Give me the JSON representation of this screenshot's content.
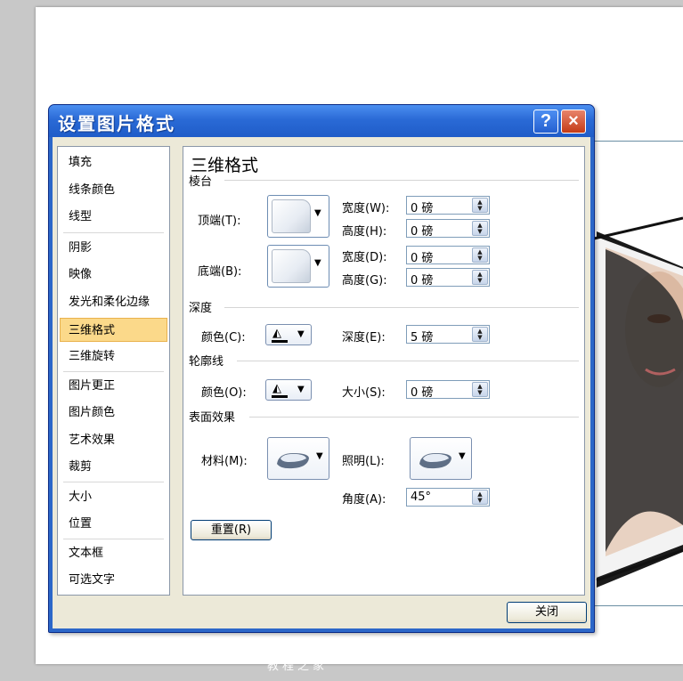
{
  "dialog": {
    "title": "设置图片格式",
    "help_label": "?",
    "close_x_label": "×",
    "close_button_label": "关闭"
  },
  "nav": {
    "items": [
      {
        "label": "填充",
        "active": false
      },
      {
        "label": "线条颜色",
        "active": false
      },
      {
        "label": "线型",
        "active": false
      },
      {
        "label": "阴影",
        "active": false
      },
      {
        "label": "映像",
        "active": false
      },
      {
        "label": "发光和柔化边缘",
        "active": false
      },
      {
        "label": "三维格式",
        "active": true
      },
      {
        "label": "三维旋转",
        "active": false
      },
      {
        "label": "图片更正",
        "active": false
      },
      {
        "label": "图片颜色",
        "active": false
      },
      {
        "label": "艺术效果",
        "active": false
      },
      {
        "label": "裁剪",
        "active": false
      },
      {
        "label": "大小",
        "active": false
      },
      {
        "label": "位置",
        "active": false
      },
      {
        "label": "文本框",
        "active": false
      },
      {
        "label": "可选文字",
        "active": false
      }
    ]
  },
  "panel": {
    "title": "三维格式",
    "bevel": {
      "section": "棱台",
      "top_label": "顶端(T):",
      "bottom_label": "底端(B):",
      "top_width_label": "宽度(W):",
      "top_width_value": "0 磅",
      "top_height_label": "高度(H):",
      "top_height_value": "0 磅",
      "bottom_width_label": "宽度(D):",
      "bottom_width_value": "0 磅",
      "bottom_height_label": "高度(G):",
      "bottom_height_value": "0 磅"
    },
    "depth": {
      "section": "深度",
      "color_label": "颜色(C):",
      "depth_label": "深度(E):",
      "depth_value": "5 磅"
    },
    "contour": {
      "section": "轮廓线",
      "color_label": "颜色(O):",
      "size_label": "大小(S):",
      "size_value": "0 磅"
    },
    "surface": {
      "section": "表面效果",
      "material_label": "材料(M):",
      "lighting_label": "照明(L):",
      "angle_label": "角度(A):",
      "angle_value": "45°"
    },
    "reset_label": "重置(R)"
  },
  "watermark": "教程之家",
  "colors": {
    "title_bar": "#2a6ad6",
    "dialog_body": "#ece9d8",
    "active_nav": "#fbd98a",
    "close_x": "#c43b16"
  },
  "icons": {
    "help": "help-icon",
    "close": "close-icon",
    "paint_bucket": "paint-bucket-icon",
    "dropdown": "chevron-down-icon",
    "spinner": "spinner-arrows-icon",
    "material": "material-preview-icon",
    "lighting": "lighting-preview-icon"
  }
}
